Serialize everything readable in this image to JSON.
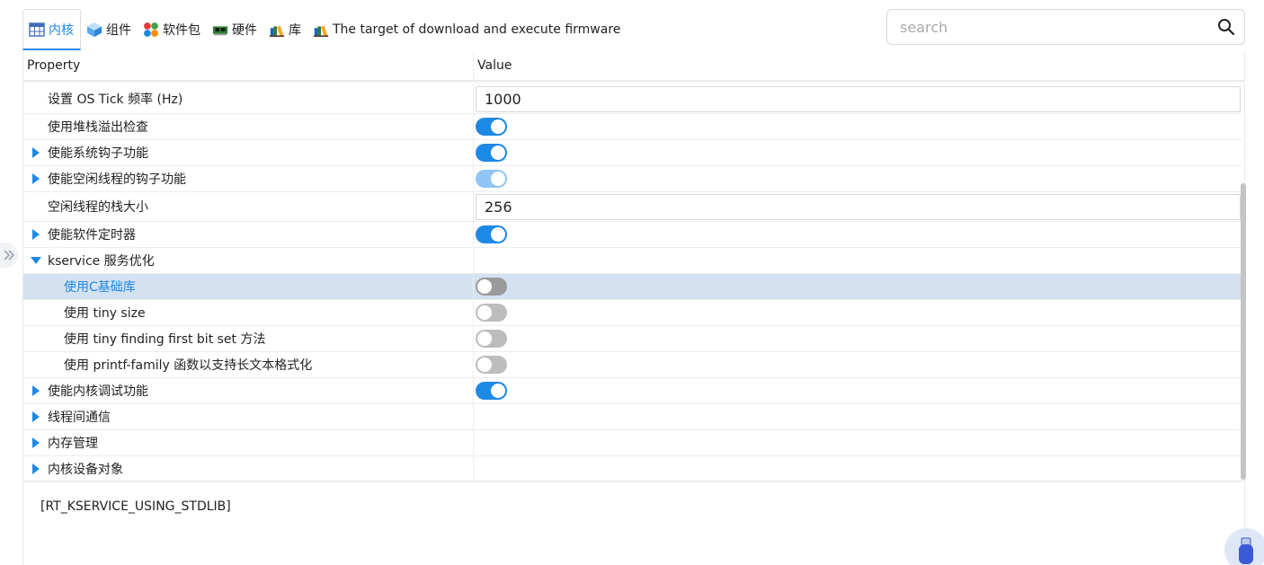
{
  "tabs": [
    {
      "label": "内核",
      "icon": "table-icon",
      "active": true
    },
    {
      "label": "组件",
      "icon": "cube-icon",
      "active": false
    },
    {
      "label": "软件包",
      "icon": "apps-icon",
      "active": false
    },
    {
      "label": "硬件",
      "icon": "board-icon",
      "active": false
    },
    {
      "label": "库",
      "icon": "books-icon",
      "active": false
    },
    {
      "label": "The target of download and execute firmware",
      "icon": "books-icon",
      "active": false
    }
  ],
  "search": {
    "placeholder": "search",
    "icon": "search-icon"
  },
  "grid": {
    "header": {
      "property": "Property",
      "value": "Value"
    },
    "rows": [
      {
        "label": "设置 OS Tick 频率 (Hz)",
        "expander": "none",
        "indent": 0,
        "type": "text",
        "value": "1000"
      },
      {
        "label": "使用堆栈溢出检查",
        "expander": "none",
        "indent": 0,
        "type": "toggle",
        "state": "on"
      },
      {
        "label": "使能系统钩子功能",
        "expander": "collapsed",
        "indent": 0,
        "type": "toggle",
        "state": "on"
      },
      {
        "label": "使能空闲线程的钩子功能",
        "expander": "collapsed",
        "indent": 0,
        "type": "toggle",
        "state": "on-disabled"
      },
      {
        "label": "空闲线程的栈大小",
        "expander": "none",
        "indent": 0,
        "type": "text",
        "value": "256"
      },
      {
        "label": "使能软件定时器",
        "expander": "collapsed",
        "indent": 0,
        "type": "toggle",
        "state": "on"
      },
      {
        "label": "kservice 服务优化",
        "expander": "expanded",
        "indent": 0,
        "type": "none"
      },
      {
        "label": "使用C基础库",
        "expander": "none",
        "indent": 1,
        "type": "toggle",
        "state": "off",
        "selected": true
      },
      {
        "label": "使用 tiny size",
        "expander": "none",
        "indent": 1,
        "type": "toggle",
        "state": "off"
      },
      {
        "label": "使用 tiny finding first bit set 方法",
        "expander": "none",
        "indent": 1,
        "type": "toggle",
        "state": "off"
      },
      {
        "label": "使用 printf-family 函数以支持长文本格式化",
        "expander": "none",
        "indent": 1,
        "type": "toggle",
        "state": "off"
      },
      {
        "label": "使能内核调试功能",
        "expander": "collapsed",
        "indent": 0,
        "type": "toggle",
        "state": "on"
      },
      {
        "label": "线程间通信",
        "expander": "collapsed",
        "indent": 0,
        "type": "none"
      },
      {
        "label": "内存管理",
        "expander": "collapsed",
        "indent": 0,
        "type": "none"
      },
      {
        "label": "内核设备对象",
        "expander": "collapsed",
        "indent": 0,
        "type": "none"
      }
    ]
  },
  "description": "[RT_KSERVICE_USING_STDLIB]",
  "colors": {
    "accent": "#1e88e5",
    "selection": "#d3e1f1",
    "toggle_off": "#bdbdbd"
  }
}
